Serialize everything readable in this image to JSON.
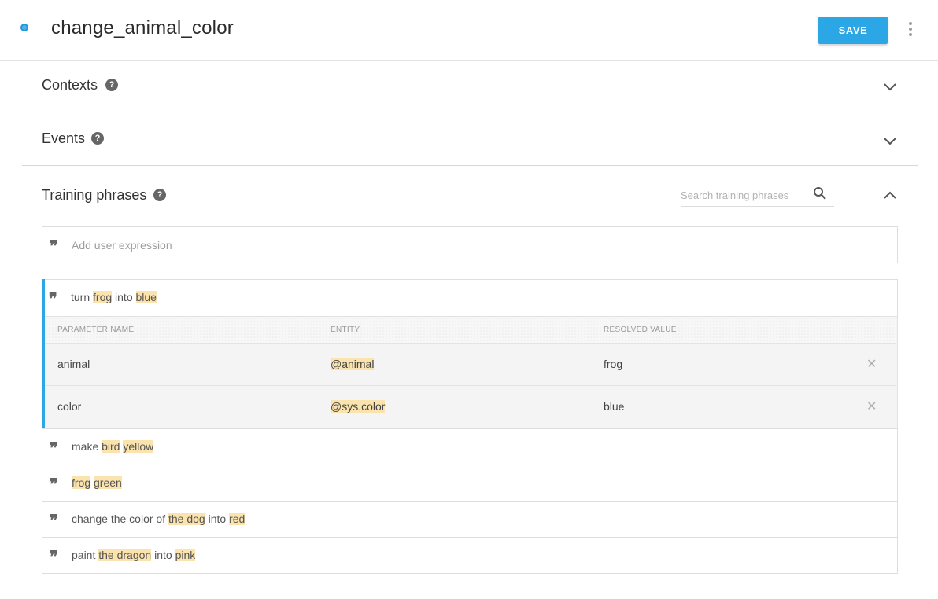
{
  "header": {
    "intent_name": "change_animal_color",
    "save_label": "SAVE"
  },
  "sections": {
    "contexts": {
      "title": "Contexts"
    },
    "events": {
      "title": "Events"
    },
    "training": {
      "title": "Training phrases",
      "search_placeholder": "Search training phrases",
      "add_placeholder": "Add user expression"
    }
  },
  "expanded_phrase": {
    "parts": [
      {
        "text": "turn ",
        "hl": false
      },
      {
        "text": "frog",
        "hl": true
      },
      {
        "text": " into ",
        "hl": false
      },
      {
        "text": "blue",
        "hl": true
      }
    ],
    "headers": {
      "name": "PARAMETER NAME",
      "entity": "ENTITY",
      "value": "RESOLVED VALUE"
    },
    "params": [
      {
        "name": "animal",
        "entity": "@animal",
        "value": "frog"
      },
      {
        "name": "color",
        "entity": "@sys.color",
        "value": "blue"
      }
    ]
  },
  "phrases": [
    {
      "parts": [
        {
          "text": "make ",
          "hl": false
        },
        {
          "text": "bird",
          "hl": true
        },
        {
          "text": " ",
          "hl": false
        },
        {
          "text": "yellow",
          "hl": true
        }
      ]
    },
    {
      "parts": [
        {
          "text": "frog",
          "hl": true
        },
        {
          "text": " ",
          "hl": false
        },
        {
          "text": "green",
          "hl": true
        }
      ]
    },
    {
      "parts": [
        {
          "text": "change the color of ",
          "hl": false
        },
        {
          "text": "the dog",
          "hl": true
        },
        {
          "text": " into ",
          "hl": false
        },
        {
          "text": "red",
          "hl": true
        }
      ]
    },
    {
      "parts": [
        {
          "text": "paint ",
          "hl": false
        },
        {
          "text": "the dragon",
          "hl": true
        },
        {
          "text": " into ",
          "hl": false
        },
        {
          "text": "pink",
          "hl": true
        }
      ]
    }
  ],
  "colors": {
    "accent": "#2ca7e6",
    "highlight": "#fbe3ad"
  },
  "icons": {
    "status": "status-dot-icon",
    "more": "more-vert-icon",
    "help": "help-circle-icon",
    "chevron_down": "chevron-down-icon",
    "chevron_up": "chevron-up-icon",
    "search": "search-icon",
    "quote": "quote-icon",
    "remove": "close-icon"
  }
}
